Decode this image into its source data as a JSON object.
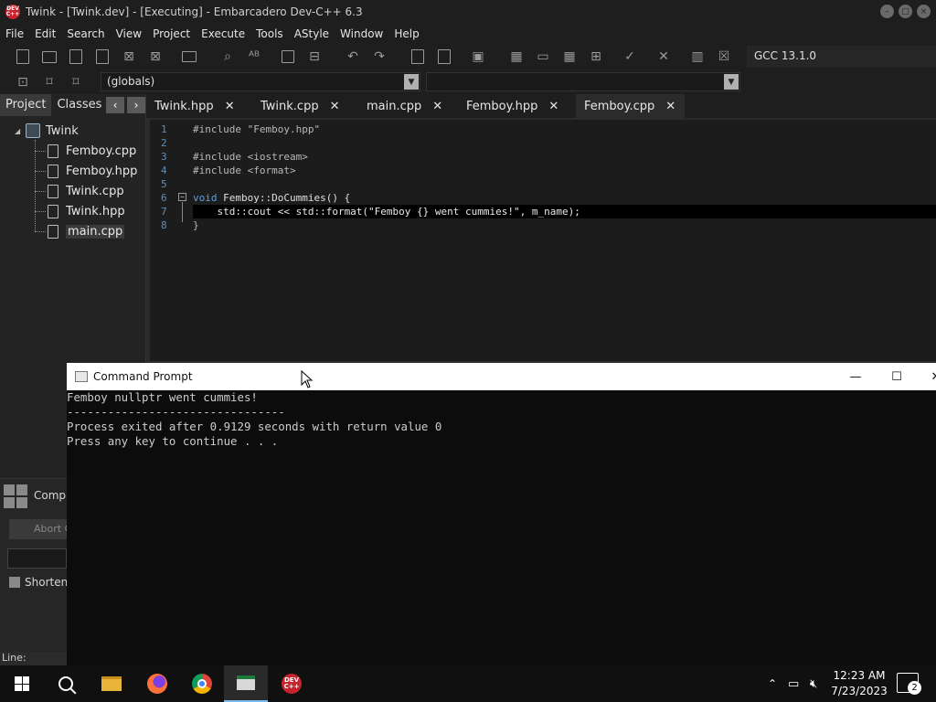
{
  "window": {
    "title": "Twink - [Twink.dev] - [Executing] - Embarcadero Dev-C++ 6.3",
    "logo_text": "DEV C++"
  },
  "menu": [
    "File",
    "Edit",
    "Search",
    "View",
    "Project",
    "Execute",
    "Tools",
    "AStyle",
    "Window",
    "Help"
  ],
  "toolbar": {
    "compiler": "GCC 13.1.0",
    "scope_select": "(globals)"
  },
  "left_panel": {
    "tabs": [
      "Project",
      "Classes"
    ],
    "tree_root": "Twink",
    "files": [
      "Femboy.cpp",
      "Femboy.hpp",
      "Twink.cpp",
      "Twink.hpp",
      "main.cpp"
    ]
  },
  "editor_tabs": [
    "Twink.hpp",
    "Twink.cpp",
    "main.cpp",
    "Femboy.hpp",
    "Femboy.cpp"
  ],
  "editor": {
    "line_numbers": [
      "1",
      "2",
      "3",
      "4",
      "5",
      "6",
      "7",
      "8"
    ],
    "lines": [
      "#include \"Femboy.hpp\"",
      "",
      "#include <iostream>",
      "#include <format>",
      "",
      "void Femboy::DoCummies() {",
      "    std::cout << std::format(\"Femboy {} went cummies!\", m_name);",
      "}"
    ],
    "kw_void": "void",
    "fn_rest": " Femboy::DoCummies() {"
  },
  "bottom_panel": {
    "compiler_label": "Compi",
    "abort_label": "Abort C",
    "shorten_label": "Shorten",
    "status_line": "Line:"
  },
  "cmd": {
    "title": "Command Prompt",
    "output": [
      "Femboy nullptr went cummies!",
      "--------------------------------",
      "Process exited after 0.9129 seconds with return value 0",
      "Press any key to continue . . ."
    ]
  },
  "taskbar": {
    "time": "12:23 AM",
    "date": "7/23/2023",
    "notification_count": "2",
    "devcpp_label": "DEV C++"
  }
}
